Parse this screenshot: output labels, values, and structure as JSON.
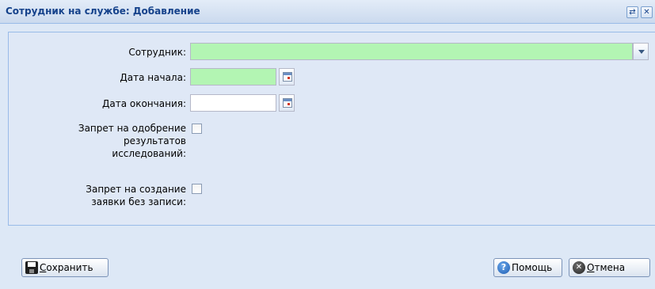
{
  "window": {
    "title": "Сотрудник на службе: Добавление",
    "tools": {
      "refresh_glyph": "⇄",
      "close_glyph": "✕"
    }
  },
  "form": {
    "employee": {
      "label": "Сотрудник:",
      "value": ""
    },
    "start_date": {
      "label": "Дата начала:",
      "value": ""
    },
    "end_date": {
      "label": "Дата окончания:",
      "value": ""
    },
    "ban_approve": {
      "label_lines": [
        "Запрет на одобрение",
        "результатов",
        "исследований:"
      ],
      "checked": false
    },
    "ban_create": {
      "label_lines": [
        "Запрет на создание",
        "заявки без записи:"
      ],
      "checked": false
    }
  },
  "footer": {
    "save": {
      "underlined": "С",
      "rest": "охранить"
    },
    "help": {
      "label": "Помощь",
      "icon_glyph": "?"
    },
    "cancel": {
      "underlined": "О",
      "rest": "тмена",
      "icon_glyph": "✕"
    }
  },
  "colors": {
    "required_field": "#b3f5b3",
    "title_text": "#15428b",
    "panel_bg": "#dfe8f6"
  }
}
